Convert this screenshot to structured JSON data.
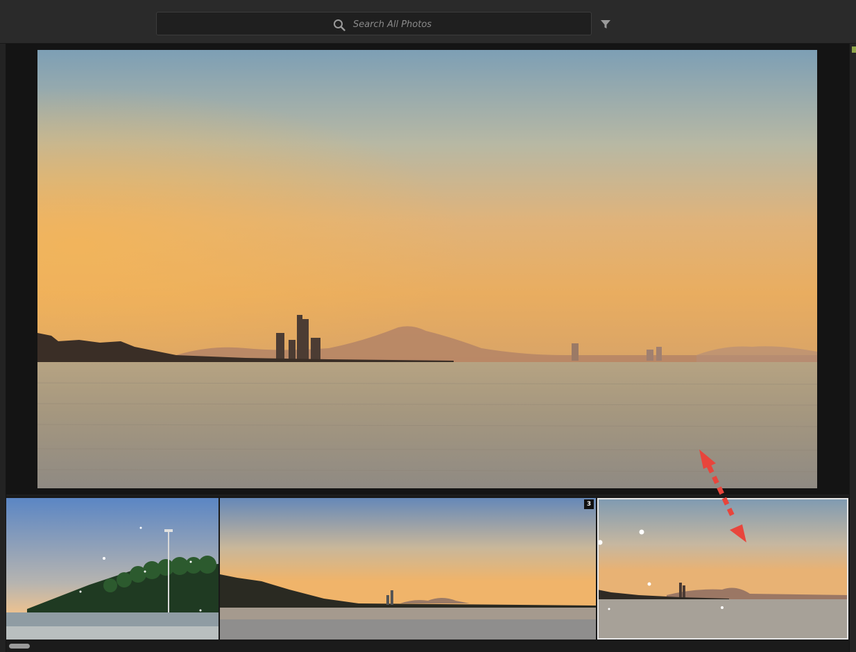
{
  "search": {
    "placeholder": "Search All Photos",
    "icon": "search-icon"
  },
  "toolbar": {
    "filter_icon": "filter-icon"
  },
  "filmstrip": {
    "stack_badge": "3",
    "thumbnails": [
      {
        "id": "beach-palms"
      },
      {
        "id": "coast-wide"
      },
      {
        "id": "coast-skyline",
        "selected": true
      }
    ]
  },
  "colors": {
    "accent_arrow": "#e8453c",
    "selection_border": "#e6e6e6"
  }
}
